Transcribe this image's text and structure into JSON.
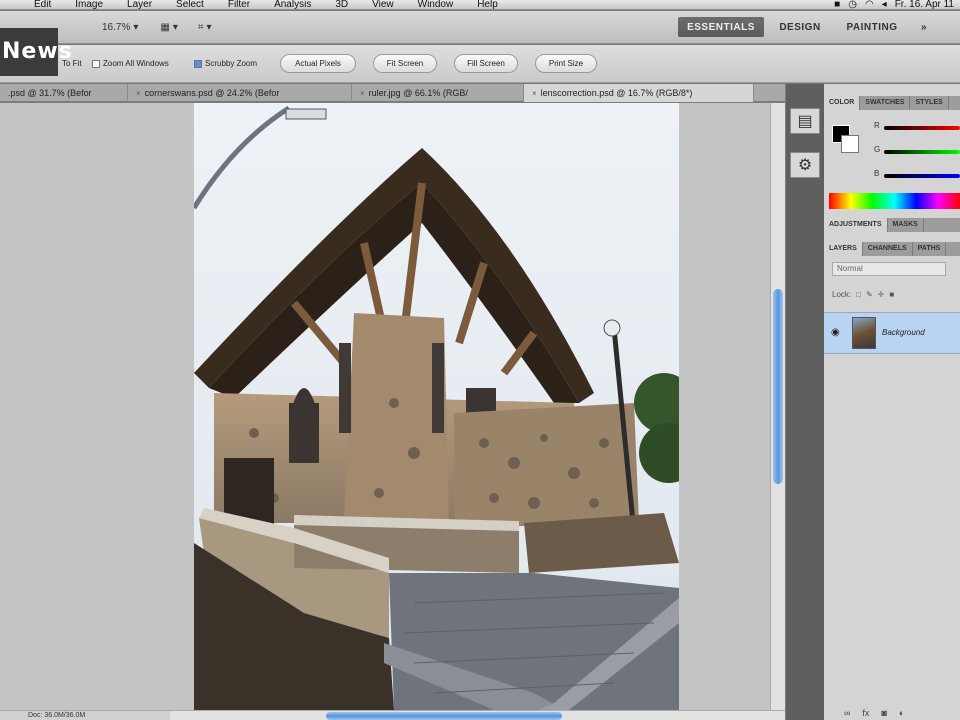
{
  "menubar": {
    "items": [
      "Edit",
      "Image",
      "Layer",
      "Select",
      "Filter",
      "Analysis",
      "3D",
      "View",
      "Window",
      "Help"
    ],
    "clock": "Fr. 16. Apr 11"
  },
  "appbar": {
    "zoom": "16.7%",
    "workspaces": [
      "ESSENTIALS",
      "DESIGN",
      "PAINTING",
      "»"
    ]
  },
  "options": {
    "logo": "News",
    "resize_label": "To Fit",
    "zoom_all": "Zoom All Windows",
    "scrubby": "Scrubby Zoom",
    "buttons": [
      "Actual Pixels",
      "Fit Screen",
      "Fill Screen",
      "Print Size"
    ]
  },
  "tabs": [
    {
      "label": ".psd @ 31.7% (Befor",
      "active": false
    },
    {
      "label": "cornerswans.psd @ 24.2% (Befor",
      "active": false
    },
    {
      "label": "ruler.jpg @ 66.1% (RGB/",
      "active": false
    },
    {
      "label": "lenscorrection.psd @ 16.7% (RGB/8*)",
      "active": true
    }
  ],
  "status": {
    "doc": "Doc: 36.0M/36.0M"
  },
  "panels": {
    "color_tabs": [
      "COLOR",
      "SWATCHES",
      "STYLES"
    ],
    "sliders": [
      "R",
      "G",
      "B"
    ],
    "adj_tabs": [
      "ADJUSTMENTS",
      "MASKS"
    ],
    "layer_tabs": [
      "LAYERS",
      "CHANNELS",
      "PATHS"
    ],
    "blend_mode": "Normal",
    "lock_label": "Lock:",
    "layer_name": "Background"
  },
  "colors": {
    "accent": "#5a94dd",
    "layer_selected": "#b9d3f2"
  }
}
